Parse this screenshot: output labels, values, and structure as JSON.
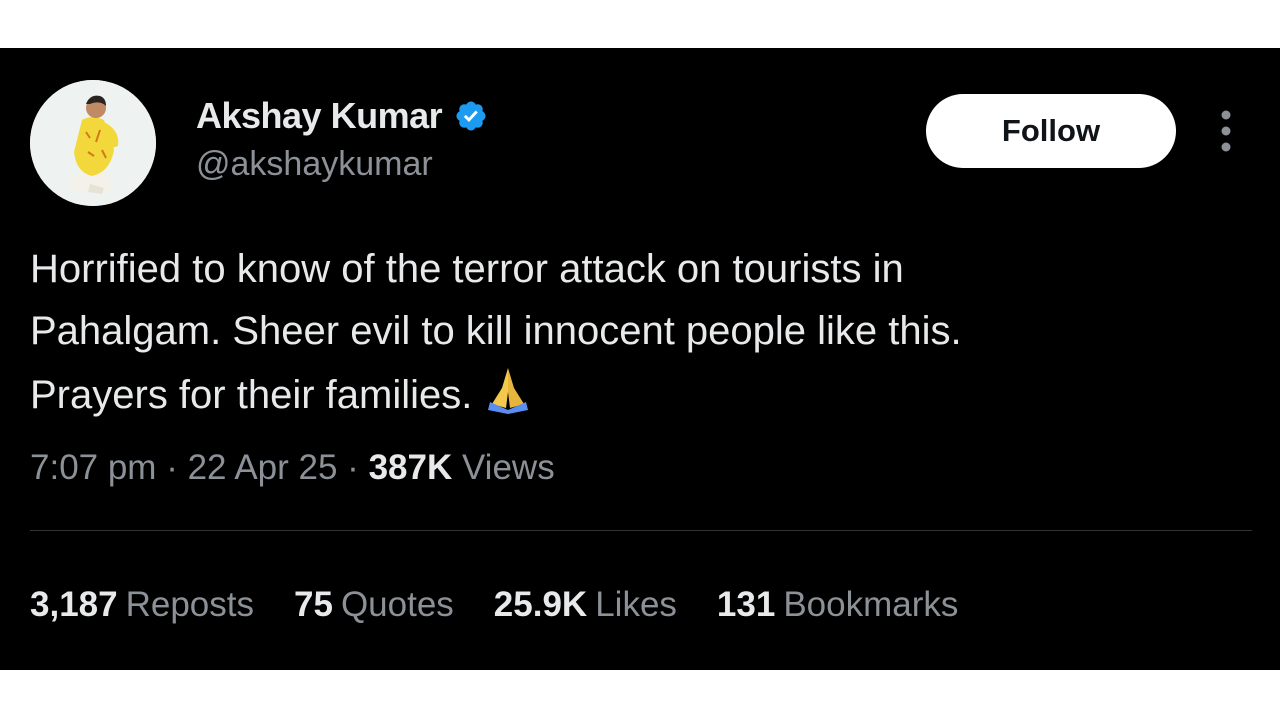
{
  "author": {
    "name": "Akshay Kumar",
    "handle": "@akshaykumar",
    "verified": true,
    "avatar_icon": "profile-photo"
  },
  "follow_button": {
    "label": "Follow"
  },
  "more_icon": "vertical-ellipsis-icon",
  "tweet": {
    "lines": [
      "Horrified to know of the terror attack on tourists in",
      "Pahalgam. Sheer evil to kill innocent people like this.",
      "Prayers for their families."
    ],
    "emoji": "folded-hands"
  },
  "meta": {
    "time": "7:07 pm",
    "date": "22 Apr 25",
    "views_count": "387K",
    "views_label": "Views",
    "separator": "·"
  },
  "stats": {
    "reposts": {
      "count": "3,187",
      "label": "Reposts"
    },
    "quotes": {
      "count": "75",
      "label": "Quotes"
    },
    "likes": {
      "count": "25.9K",
      "label": "Likes"
    },
    "bookmarks": {
      "count": "131",
      "label": "Bookmarks"
    }
  },
  "colors": {
    "background": "#000000",
    "text": "#e7e9ea",
    "muted": "#8b9197",
    "verified_blue": "#1d9bf0",
    "divider": "#2f3336"
  }
}
